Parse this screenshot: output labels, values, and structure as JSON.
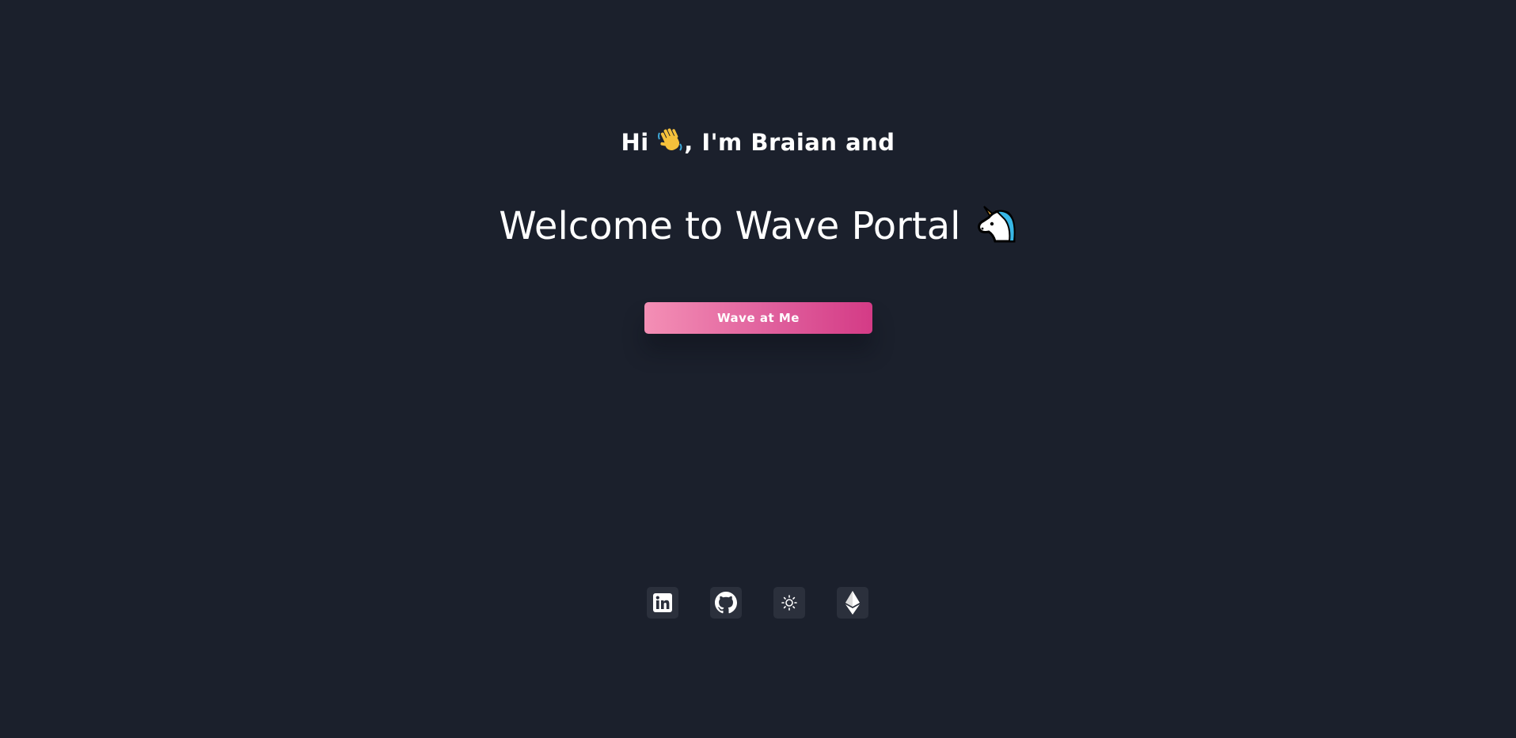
{
  "header": {
    "greeting_prefix": "Hi ",
    "greeting_suffix": ", I'm Braian and",
    "title": "Welcome to Wave Portal "
  },
  "actions": {
    "wave_button_label": "Wave at Me"
  },
  "colors": {
    "background": "#1b202c",
    "button_gradient_start": "#f48fb5",
    "button_gradient_end": "#d43b86",
    "icon_tile": "#2b303c"
  },
  "socials": [
    {
      "icon": "linkedin-icon"
    },
    {
      "icon": "github-icon"
    },
    {
      "icon": "sun-icon"
    },
    {
      "icon": "ethereum-icon"
    }
  ]
}
